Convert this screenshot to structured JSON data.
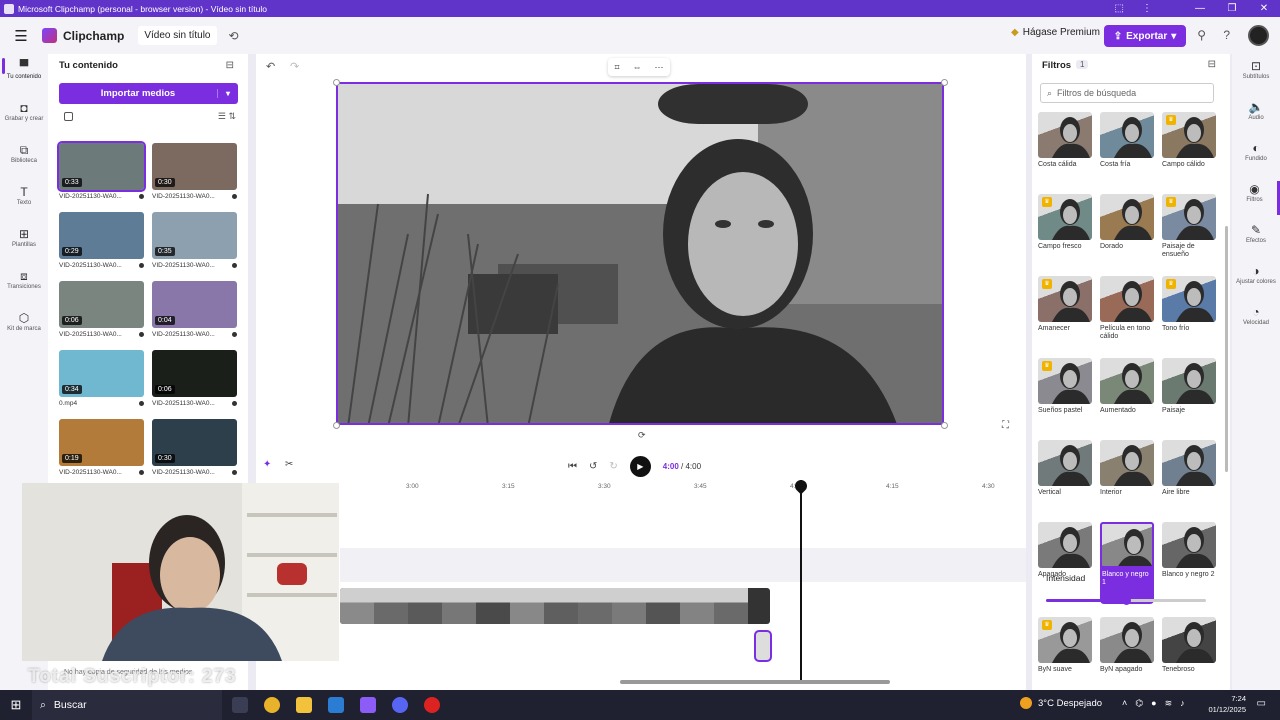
{
  "window": {
    "title": "Microsoft Clipchamp (personal - browser version) - Vídeo sin título",
    "controls": [
      "—",
      "❐",
      "✕"
    ],
    "extensions": [
      "⬚",
      "⋮"
    ]
  },
  "appbar": {
    "brand": "Clipchamp",
    "video_title": "Vídeo sin título",
    "premium": "Hágase Premium",
    "export": "Exportar"
  },
  "left_rail": [
    {
      "label": "Tu contenido",
      "icon": "folder-icon"
    },
    {
      "label": "Grabar y crear",
      "icon": "camera-icon"
    },
    {
      "label": "Biblioteca",
      "icon": "library-icon"
    },
    {
      "label": "Texto",
      "icon": "text-icon"
    },
    {
      "label": "Plantillas",
      "icon": "templates-icon"
    },
    {
      "label": "Transiciones",
      "icon": "transitions-icon"
    },
    {
      "label": "Kit de marca",
      "icon": "brand-kit-icon"
    }
  ],
  "content_panel": {
    "title": "Tu contenido",
    "import": "Importar medios",
    "media": [
      {
        "duration": "0:33",
        "name": "VID-20251130-WA0...",
        "bg": "#6c7a7a"
      },
      {
        "duration": "0:30",
        "name": "VID-20251130-WA0...",
        "bg": "#7c6a60"
      },
      {
        "duration": "0:29",
        "name": "VID-20251130-WA0...",
        "bg": "#5e7c96"
      },
      {
        "duration": "0:35",
        "name": "VID-20251130-WA0...",
        "bg": "#8ca0b0"
      },
      {
        "duration": "0:06",
        "name": "VID-20251130-WA0...",
        "bg": "#7a8580"
      },
      {
        "duration": "0:04",
        "name": "VID-20251130-WA0...",
        "bg": "#8877a8"
      },
      {
        "duration": "0:34",
        "name": "0.mp4",
        "bg": "#6fb8cf"
      },
      {
        "duration": "0:06",
        "name": "VID-20251130-WA0...",
        "bg": "#1b1f1a"
      },
      {
        "duration": "0:19",
        "name": "VID-20251130-WA0...",
        "bg": "#b37b3a"
      },
      {
        "duration": "0:30",
        "name": "VID-20251130-WA0...",
        "bg": "#2c3f4a"
      }
    ],
    "selected_index": 0
  },
  "player": {
    "current": "4:00",
    "total": "4:00"
  },
  "ruler": [
    "3:00",
    "3:15",
    "3:30",
    "3:45",
    "4:00",
    "4:15",
    "4:30"
  ],
  "filters": {
    "title": "Filtros",
    "count": "1",
    "search_placeholder": "Filtros de búsqueda",
    "items": [
      {
        "label": "Costa cálida",
        "premium": false,
        "tint": "#8a7a70"
      },
      {
        "label": "Costa fría",
        "premium": false,
        "tint": "#6f8a9a"
      },
      {
        "label": "Campo cálido",
        "premium": true,
        "tint": "#8a7860"
      },
      {
        "label": "Campo fresco",
        "premium": true,
        "tint": "#708a88"
      },
      {
        "label": "Dorado",
        "premium": false,
        "tint": "#9a7a50"
      },
      {
        "label": "Paisaje de ensueño",
        "premium": true,
        "tint": "#7a8aa0"
      },
      {
        "label": "Amanecer",
        "premium": true,
        "tint": "#8a7068"
      },
      {
        "label": "Película en tono cálido",
        "premium": false,
        "tint": "#9a6a58"
      },
      {
        "label": "Tono frío",
        "premium": true,
        "tint": "#5a7aa8"
      },
      {
        "label": "Sueños pastel",
        "premium": true,
        "tint": "#8a8a90"
      },
      {
        "label": "Aumentado",
        "premium": false,
        "tint": "#7a8878"
      },
      {
        "label": "Paisaje",
        "premium": false,
        "tint": "#6a7a70"
      },
      {
        "label": "Vertical",
        "premium": false,
        "tint": "#707a7a"
      },
      {
        "label": "Interior",
        "premium": false,
        "tint": "#8a8070"
      },
      {
        "label": "Aire libre",
        "premium": false,
        "tint": "#708090"
      },
      {
        "label": "Apagado",
        "premium": false,
        "tint": "#7a7a7a"
      },
      {
        "label": "Blanco y negro 1",
        "premium": false,
        "tint": "#888888"
      },
      {
        "label": "Blanco y negro 2",
        "premium": false,
        "tint": "#666666"
      }
    ],
    "selected": "Blanco y negro 1",
    "intensity_label": "Intensidad",
    "intensity": 0.5,
    "items2": [
      {
        "label": "ByN suave",
        "premium": true,
        "tint": "#999999"
      },
      {
        "label": "ByN apagado",
        "premium": false,
        "tint": "#8a8a8a"
      },
      {
        "label": "Tenebroso",
        "premium": false,
        "tint": "#444444"
      }
    ]
  },
  "right_rail": [
    {
      "label": "Subtítulos",
      "icon": "captions-icon"
    },
    {
      "label": "Audio",
      "icon": "speaker-icon"
    },
    {
      "label": "Fundido",
      "icon": "fade-icon"
    },
    {
      "label": "Filtros",
      "icon": "filters-icon"
    },
    {
      "label": "Efectos",
      "icon": "effects-icon"
    },
    {
      "label": "Ajustar colores",
      "icon": "adjust-colors-icon"
    },
    {
      "label": "Velocidad",
      "icon": "speed-icon"
    }
  ],
  "webcam_caption": "No hay copia de seguridad de los medios",
  "subscriptor": "Total Suscriptor: 273",
  "taskbar": {
    "search": "Buscar",
    "weather": "3°C Despejado",
    "time": "7:24",
    "date": "01/12/2025"
  }
}
